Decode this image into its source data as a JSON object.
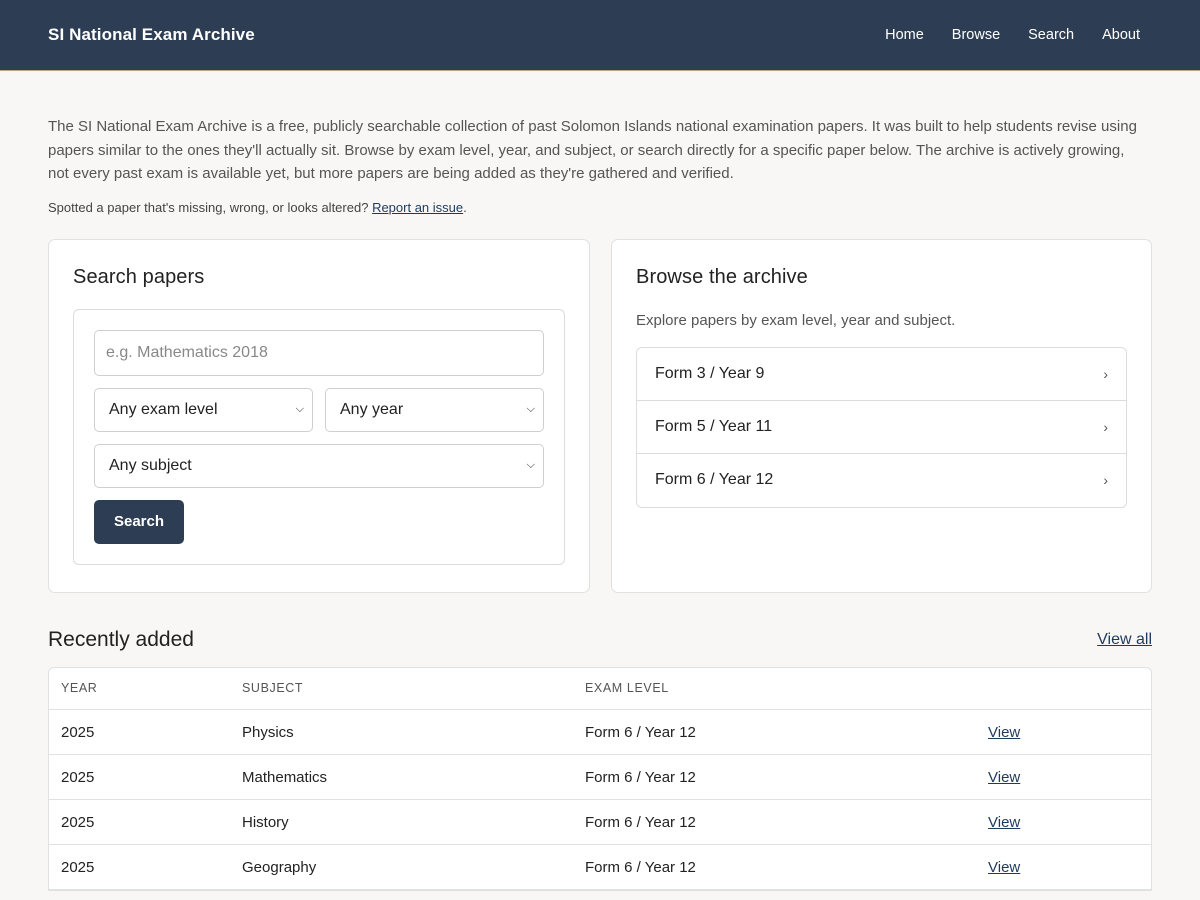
{
  "header": {
    "brand": "SI National Exam Archive",
    "nav": [
      "Home",
      "Browse",
      "Search",
      "About"
    ]
  },
  "intro": {
    "text": "The SI National Exam Archive is a free, publicly searchable collection of past Solomon Islands national examination papers. It was built to help students revise using papers similar to the ones they'll actually sit. Browse by exam level, year, and subject, or search directly for a specific paper below. The archive is actively growing, not every past exam is available yet, but more papers are being added as they're gathered and verified.",
    "report_prefix": "Spotted a paper that's missing, wrong, or looks altered?",
    "report_link": "Report an issue",
    "report_suffix": "."
  },
  "search": {
    "title": "Search papers",
    "placeholder": "e.g. Mathematics 2018",
    "level_select": "Any exam level",
    "year_select": "Any year",
    "subject_select": "Any subject",
    "button": "Search"
  },
  "browse": {
    "title": "Browse the archive",
    "subtitle": "Explore papers by exam level, year and subject.",
    "levels": [
      "Form 3 / Year 9",
      "Form 5 / Year 11",
      "Form 6 / Year 12"
    ]
  },
  "recent": {
    "title": "Recently added",
    "view_all": "View all",
    "columns": [
      "YEAR",
      "SUBJECT",
      "EXAM LEVEL",
      ""
    ],
    "rows": [
      {
        "year": "2025",
        "subject": "Physics",
        "level": "Form 6 / Year 12",
        "action": "View"
      },
      {
        "year": "2025",
        "subject": "Mathematics",
        "level": "Form 6 / Year 12",
        "action": "View"
      },
      {
        "year": "2025",
        "subject": "History",
        "level": "Form 6 / Year 12",
        "action": "View"
      },
      {
        "year": "2025",
        "subject": "Geography",
        "level": "Form 6 / Year 12",
        "action": "View"
      }
    ]
  },
  "colors": {
    "navbar": "#2d3e54",
    "accent_link": "#1e3a5f",
    "background": "#f8f7f5"
  }
}
